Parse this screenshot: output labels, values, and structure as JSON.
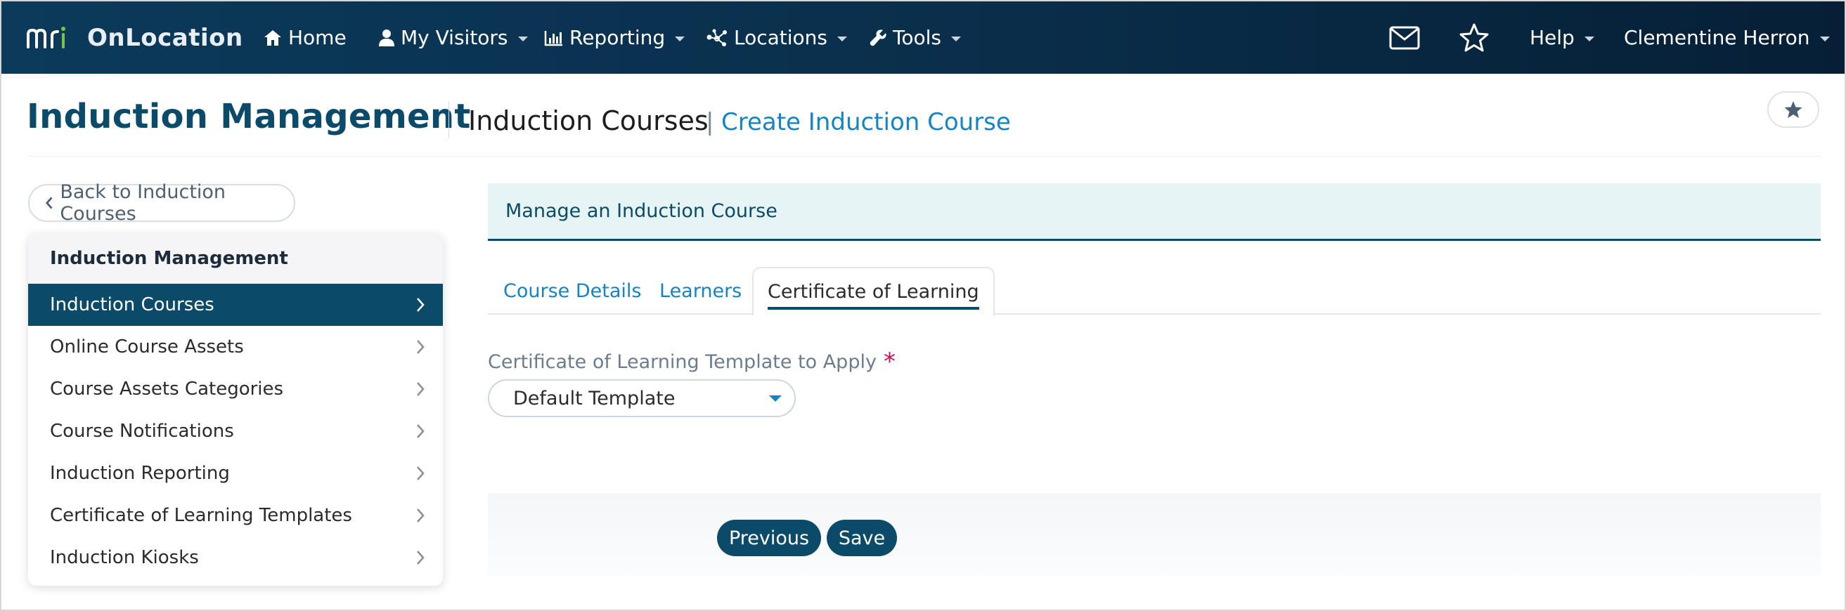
{
  "app": {
    "brand_name": "OnLocation",
    "logo_text": "mri"
  },
  "nav": {
    "items": [
      {
        "label": "Home",
        "icon": "home-icon",
        "has_caret": false
      },
      {
        "label": "My Visitors",
        "icon": "user-icon",
        "has_caret": true
      },
      {
        "label": "Reporting",
        "icon": "bar-chart-icon",
        "has_caret": true
      },
      {
        "label": "Locations",
        "icon": "network-icon",
        "has_caret": true
      },
      {
        "label": "Tools",
        "icon": "wrench-icon",
        "has_caret": true
      }
    ],
    "right": {
      "mail_icon": "mail-icon",
      "star_icon": "star-icon",
      "help_label": "Help",
      "user_name": "Clementine Herron"
    }
  },
  "header": {
    "title": "Induction Management",
    "breadcrumb_current": "Induction Courses",
    "breadcrumb_separator": "|",
    "breadcrumb_action": "Create Induction Course",
    "favorite_icon": "star-filled-icon"
  },
  "sidebar": {
    "back_label": "Back to Induction Courses",
    "heading": "Induction Management",
    "items": [
      {
        "label": "Induction Courses",
        "active": true
      },
      {
        "label": "Online Course Assets",
        "active": false
      },
      {
        "label": "Course Assets Categories",
        "active": false
      },
      {
        "label": "Course Notifications",
        "active": false
      },
      {
        "label": "Induction Reporting",
        "active": false
      },
      {
        "label": "Certificate of Learning Templates",
        "active": false
      },
      {
        "label": "Induction Kiosks",
        "active": false
      }
    ]
  },
  "main": {
    "panel_title": "Manage an Induction Course",
    "tabs": [
      {
        "label": "Course Details",
        "active": false
      },
      {
        "label": "Learners",
        "active": false
      },
      {
        "label": "Certificate of Learning",
        "active": true
      }
    ],
    "form": {
      "template_label": "Certificate of Learning Template to Apply",
      "required_mark": "*",
      "template_value": "Default Template"
    },
    "buttons": {
      "previous": "Previous",
      "save": "Save"
    }
  },
  "colors": {
    "nav_bg": "#0b3a5a",
    "accent": "#0b4a68",
    "link": "#1584c4",
    "required": "#c4105a",
    "panel_head_bg": "#e6f4f5"
  }
}
